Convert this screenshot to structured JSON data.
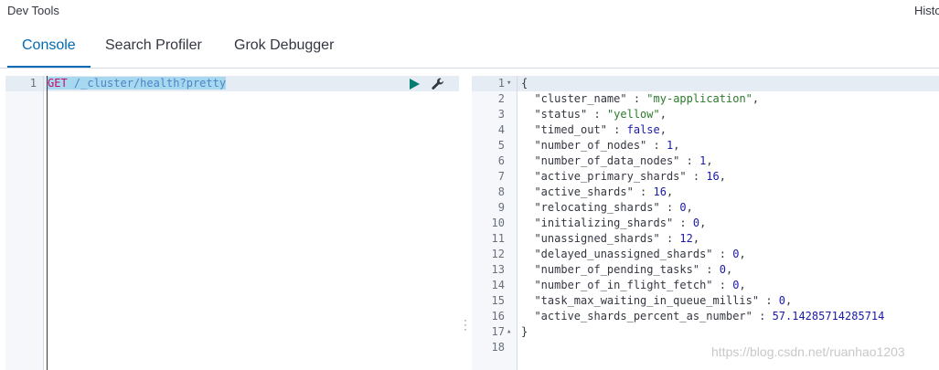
{
  "app": {
    "title": "Dev Tools",
    "history_label": "Histo"
  },
  "tabs": [
    {
      "label": "Console",
      "active": true
    },
    {
      "label": "Search Profiler",
      "active": false
    },
    {
      "label": "Grok Debugger",
      "active": false
    }
  ],
  "request": {
    "line_number": "1",
    "method": "GET",
    "path": " /_cluster/health?pretty",
    "send_icon": "play-icon",
    "settings_icon": "wrench-icon"
  },
  "response": {
    "line_numbers": [
      "1",
      "2",
      "3",
      "4",
      "5",
      "6",
      "7",
      "8",
      "9",
      "10",
      "11",
      "12",
      "13",
      "14",
      "15",
      "16",
      "17",
      "18"
    ],
    "open_brace": "{",
    "close_brace": "}",
    "fields": [
      {
        "key": "\"cluster_name\"",
        "value": "\"my-application\"",
        "type": "string",
        "comma": true
      },
      {
        "key": "\"status\"",
        "value": "\"yellow\"",
        "type": "string",
        "comma": true
      },
      {
        "key": "\"timed_out\"",
        "value": "false",
        "type": "bool",
        "comma": true
      },
      {
        "key": "\"number_of_nodes\"",
        "value": "1",
        "type": "number",
        "comma": true
      },
      {
        "key": "\"number_of_data_nodes\"",
        "value": "1",
        "type": "number",
        "comma": true
      },
      {
        "key": "\"active_primary_shards\"",
        "value": "16",
        "type": "number",
        "comma": true
      },
      {
        "key": "\"active_shards\"",
        "value": "16",
        "type": "number",
        "comma": true
      },
      {
        "key": "\"relocating_shards\"",
        "value": "0",
        "type": "number",
        "comma": true
      },
      {
        "key": "\"initializing_shards\"",
        "value": "0",
        "type": "number",
        "comma": true
      },
      {
        "key": "\"unassigned_shards\"",
        "value": "12",
        "type": "number",
        "comma": true
      },
      {
        "key": "\"delayed_unassigned_shards\"",
        "value": "0",
        "type": "number",
        "comma": true
      },
      {
        "key": "\"number_of_pending_tasks\"",
        "value": "0",
        "type": "number",
        "comma": true
      },
      {
        "key": "\"number_of_in_flight_fetch\"",
        "value": "0",
        "type": "number",
        "comma": true
      },
      {
        "key": "\"task_max_waiting_in_queue_millis\"",
        "value": "0",
        "type": "number",
        "comma": true
      },
      {
        "key": "\"active_shards_percent_as_number\"",
        "value": "57.14285714285714",
        "type": "number",
        "comma": false
      }
    ]
  },
  "watermark": "https://blog.csdn.net/ruanhao1203",
  "colors": {
    "accent": "#006bb4",
    "string": "#2a7a2a",
    "number": "#1a1aa6",
    "method": "#c80a68"
  }
}
